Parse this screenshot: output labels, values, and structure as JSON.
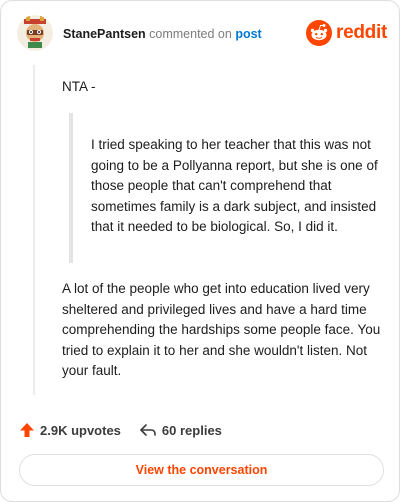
{
  "header": {
    "username": "StanePantsen",
    "action": "commented on",
    "target_link": "post",
    "brand": "reddit"
  },
  "comment": {
    "opener": "NTA -",
    "quote": "I tried speaking to her teacher that this was not going to be a Pollyanna report, but she is one of those people that can't comprehend that sometimes family is a dark subject, and insisted that it needed to be biological. So, I did it.",
    "body": "A lot of the people who get into education lived very sheltered and privileged lives and have a hard time comprehending the hardships some people face. You tried to explain it to her and she wouldn't listen. Not your fault."
  },
  "stats": {
    "upvotes": "2.9K upvotes",
    "replies": "60 replies"
  },
  "cta": {
    "label": "View the conversation"
  },
  "colors": {
    "accent": "#ff4500",
    "link": "#0079d3"
  },
  "icons": [
    "avatar-icon",
    "reddit-logo-icon",
    "upvote-arrow-icon",
    "reply-icon"
  ]
}
